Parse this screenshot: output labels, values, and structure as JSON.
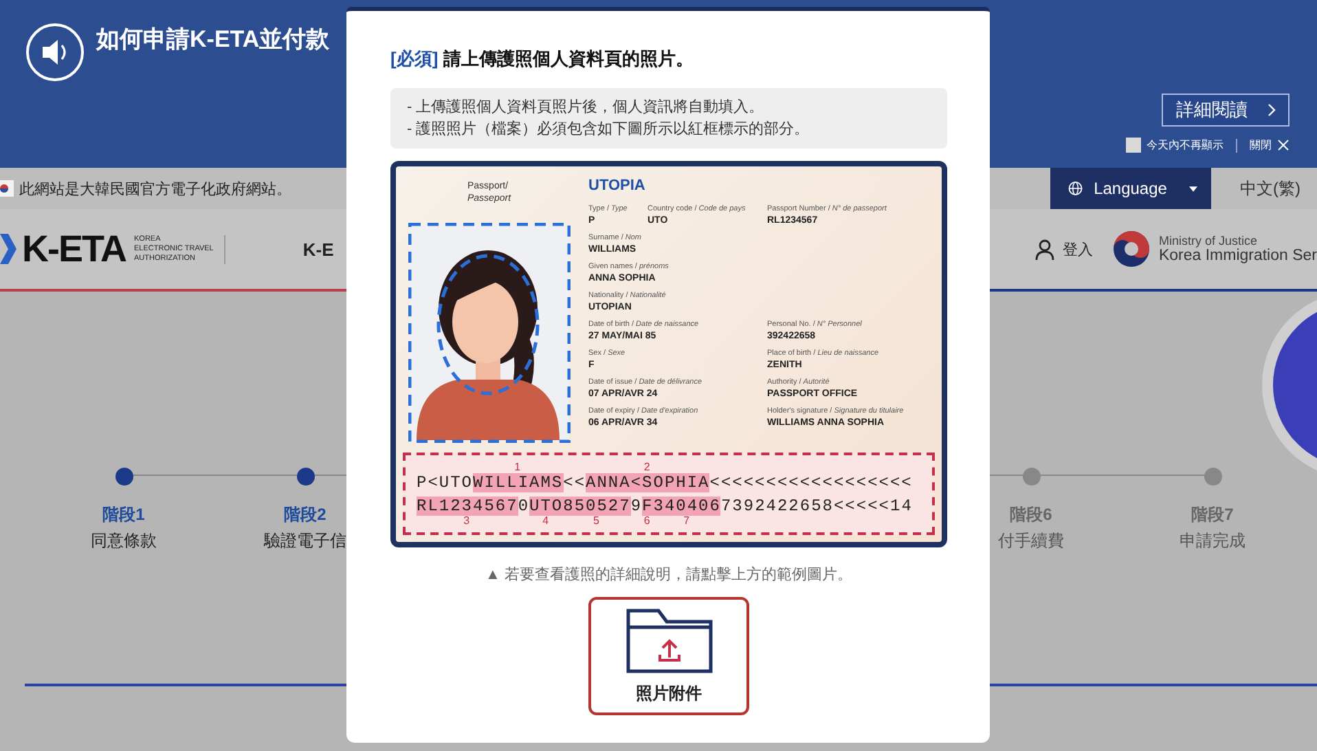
{
  "banner": {
    "title": "如何申請K-ETA並付款",
    "read_more": "詳細閱讀",
    "hide_today": {
      "label": "今天內不再顯示",
      "checked": false
    },
    "close": "關閉"
  },
  "gov_bar": {
    "notice": "此網站是大韓民國官方電子化政府網站。",
    "language_button": "Language",
    "current_language": "中文(繁)"
  },
  "header": {
    "logo": "K-ETA",
    "logo_subtitle": [
      "KOREA",
      "ELECTRONIC TRAVEL",
      "AUTHORIZATION"
    ],
    "nav": [
      "K-E"
    ],
    "login": "登入",
    "ministry": "Ministry of Justice",
    "agency": "Korea Immigration Ser"
  },
  "progress": {
    "steps_before": [
      {
        "step": "階段1",
        "name": "同意條款",
        "done": true
      },
      {
        "step": "階段2",
        "name": "驗證電子信",
        "done": true
      }
    ],
    "steps_after": [
      {
        "step": "階段6",
        "name": "付手續費",
        "done": false
      },
      {
        "step": "階段7",
        "name": "申請完成",
        "done": false
      }
    ]
  },
  "modal": {
    "required_tag": "[必須]",
    "title": "請上傳護照個人資料頁的照片。",
    "notes": [
      "- 上傳護照個人資料頁照片後，個人資訊將自動填入。",
      "- 護照照片（檔案）必須包含如下圖所示以紅框標示的部分。"
    ],
    "passport": {
      "doc_label": "Passport/",
      "doc_label_fr": "Passeport",
      "country": "UTOPIA",
      "rows": [
        [
          {
            "label": "Type / *Type*",
            "value": "P"
          },
          {
            "label": "Country code / *Code de pays*",
            "value": "UTO"
          },
          {
            "label": "Passport Number / *N° de passeport*",
            "value": "RL1234567"
          }
        ],
        [
          {
            "label": "Surname / *Nom*",
            "value": "WILLIAMS"
          }
        ],
        [
          {
            "label": "Given names / *prénoms*",
            "value": "ANNA SOPHIA"
          }
        ],
        [
          {
            "label": "Nationality / *Nationalité*",
            "value": "UTOPIAN"
          }
        ],
        [
          {
            "label": "Date of birth / *Date de naissance*",
            "value": "27 MAY/MAI 85"
          },
          {
            "label": "Personal No. / *N° Personnel*",
            "value": "392422658"
          }
        ],
        [
          {
            "label": "Sex / *Sexe*",
            "value": "F"
          },
          {
            "label": "Place of birth / *Lieu de naissance*",
            "value": "ZENITH"
          }
        ],
        [
          {
            "label": "Date of issue / *Date de délivrance*",
            "value": "07 APR/AVR 24"
          },
          {
            "label": "Authority / *Autorité*",
            "value": "PASSPORT OFFICE"
          }
        ],
        [
          {
            "label": "Date of expiry / *Date d'expiration*",
            "value": "06 APR/AVR 34"
          },
          {
            "label": "Holder's signature / *Signature du titulaire*",
            "value": "WILLIAMS ANNA SOPHIA"
          }
        ]
      ],
      "mrz": [
        {
          "segments": [
            {
              "text": "P<UTO",
              "highlighted": false
            },
            {
              "text": "WILLIAMS",
              "highlighted": true,
              "marker": "1"
            },
            {
              "text": "<<",
              "highlighted": false
            },
            {
              "text": "ANNA<SOPHIA",
              "highlighted": true,
              "marker": "2"
            },
            {
              "text": "<<<<<<<<<<<<<<<<<<",
              "highlighted": false
            }
          ]
        },
        {
          "segments": [
            {
              "text": "RL1234567",
              "highlighted": true,
              "marker": "3"
            },
            {
              "text": "0",
              "highlighted": false
            },
            {
              "text": "UTO",
              "highlighted": true,
              "marker": "4"
            },
            {
              "text": "850527",
              "highlighted": true,
              "marker": "5"
            },
            {
              "text": "9",
              "highlighted": false
            },
            {
              "text": "F",
              "highlighted": true,
              "marker": "6"
            },
            {
              "text": "340406",
              "highlighted": true,
              "marker": "7"
            },
            {
              "text": "7392422658<<<<<14",
              "highlighted": false
            }
          ]
        }
      ]
    },
    "hint": "▲ 若要查看護照的詳細說明，請點擊上方的範例圖片。",
    "upload_button": "照片附件"
  }
}
